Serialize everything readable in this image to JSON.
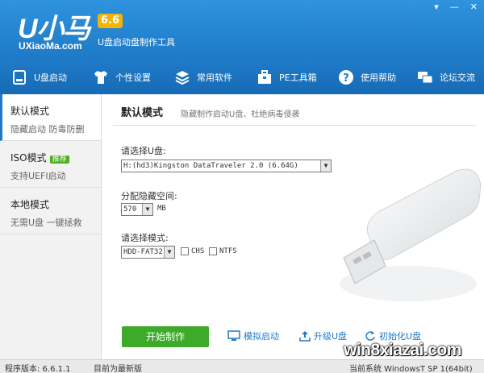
{
  "header": {
    "logo_text": "U小马",
    "version": "6.6",
    "logo_url": "UXiaoMa.com",
    "subtitle": "U盘启动盘制作工具"
  },
  "toolbar": [
    {
      "label": "U盘启动",
      "icon": "usb-drive-icon"
    },
    {
      "label": "个性设置",
      "icon": "shirt-icon"
    },
    {
      "label": "常用软件",
      "icon": "layers-icon"
    },
    {
      "label": "PE工具箱",
      "icon": "toolbox-icon"
    },
    {
      "label": "使用帮助",
      "icon": "help-icon"
    },
    {
      "label": "论坛交流",
      "icon": "chat-icon"
    }
  ],
  "sidebar": [
    {
      "title": "默认模式",
      "sub": "隐藏启动 防毒防删"
    },
    {
      "title": "ISO模式",
      "badge": "推荐",
      "sub": "支持UEFI启动"
    },
    {
      "title": "本地模式",
      "sub": "无需U盘 一键拯救"
    }
  ],
  "main": {
    "title": "默认模式",
    "desc": "隐藏制作启动U盘、杜绝病毒侵袭",
    "drive_label": "请选择U盘:",
    "drive_value": "H:(hd3)Kingston DataTraveler 2.0 (6.64G)",
    "space_label": "分配隐藏空间:",
    "space_value": "570",
    "space_unit": "MB",
    "mode_label": "请选择模式:",
    "mode_value": "HDD-FAT32",
    "chs_label": "CHS",
    "ntfs_label": "NTFS",
    "start_button": "开始制作",
    "simulate_label": "模拟启动",
    "upgrade_label": "升级U盘",
    "init_label": "初始化U盘"
  },
  "status": {
    "version_text": "程序版本: 6.6.1.1",
    "latest_text": "目前为最新版",
    "system_text": "当前系统 WindowsT SP 1(64bit)"
  },
  "watermark": "win8xiazai.com",
  "colors": {
    "accent": "#1e7ac8",
    "start": "#3eaa2a",
    "version_badge": "#f2b400"
  }
}
